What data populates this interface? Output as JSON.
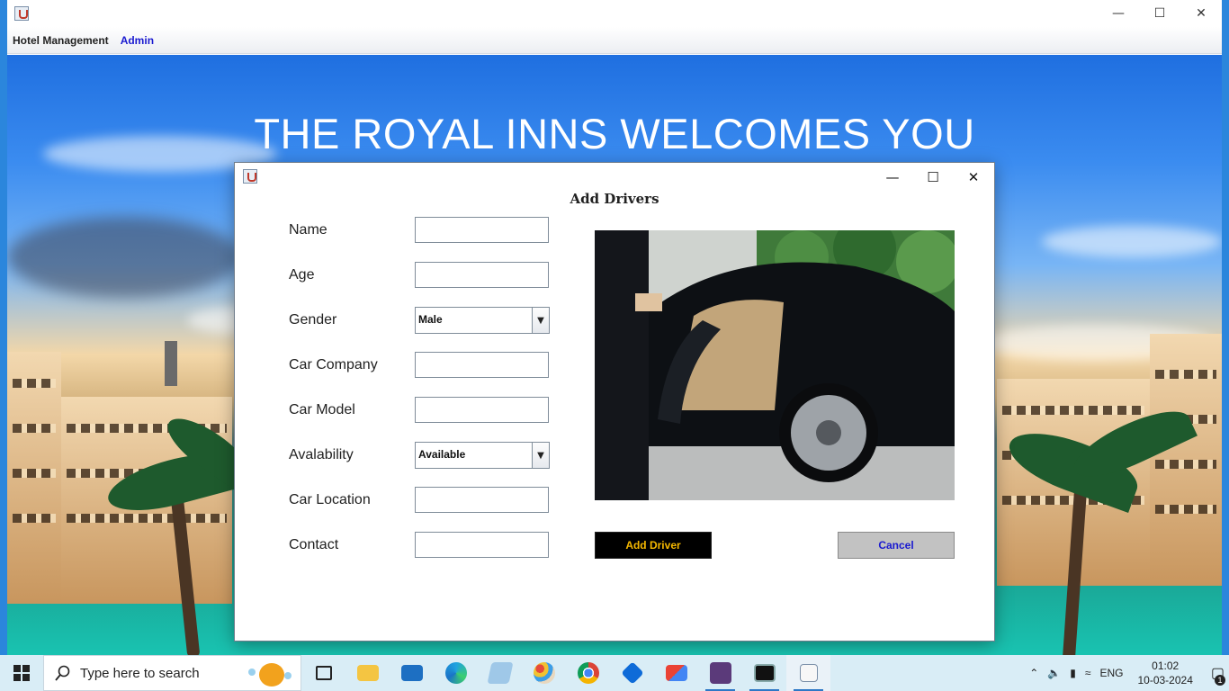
{
  "window": {
    "menu": [
      {
        "label": "Hotel Management",
        "color": "#222222"
      },
      {
        "label": "Admin",
        "color": "#1a1ad0"
      }
    ]
  },
  "background": {
    "headline": "THE ROYAL INNS WELCOMES YOU"
  },
  "dialog": {
    "title": "Add Drivers",
    "fields": {
      "name": {
        "label": "Name",
        "value": ""
      },
      "age": {
        "label": "Age",
        "value": ""
      },
      "gender": {
        "label": "Gender",
        "selected": "Male"
      },
      "car_company": {
        "label": "Car Company",
        "value": ""
      },
      "car_model": {
        "label": "Car Model",
        "value": ""
      },
      "availability": {
        "label": "Avalability",
        "selected": "Available"
      },
      "car_location": {
        "label": "Car Location",
        "value": ""
      },
      "contact": {
        "label": "Contact",
        "value": ""
      }
    },
    "buttons": {
      "add": "Add Driver",
      "cancel": "Cancel"
    }
  },
  "taskbar": {
    "search_placeholder": "Type here to search",
    "language": "ENG",
    "time": "01:02",
    "date": "10-03-2024",
    "notification_count": "1",
    "apps": [
      "task-view",
      "file-explorer",
      "mail",
      "edge",
      "notepad",
      "paint",
      "chrome",
      "teamviewer",
      "gmail",
      "game",
      "mysql",
      "java"
    ]
  }
}
